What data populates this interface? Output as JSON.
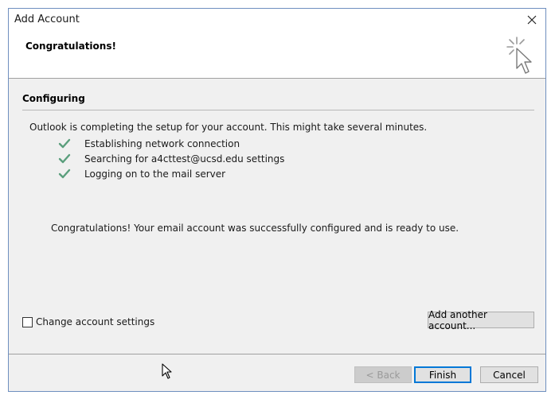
{
  "window": {
    "title": "Add Account",
    "close_glyph": "✕"
  },
  "header": {
    "title": "Congratulations!",
    "icon": "wizard-cursor-icon"
  },
  "section": {
    "title": "Configuring",
    "intro": "Outlook is completing the setup for your account. This might take several minutes.",
    "steps": [
      {
        "label": "Establishing network connection",
        "status": "done"
      },
      {
        "label": "Searching for a4cttest@ucsd.edu settings",
        "status": "done"
      },
      {
        "label": "Logging on to the mail server",
        "status": "done"
      }
    ],
    "success_message": "Congratulations! Your email account was successfully configured and is ready to use."
  },
  "options": {
    "change_settings_label": "Change account settings",
    "change_settings_checked": false,
    "add_another_label": "Add another account..."
  },
  "footer": {
    "back_label": "< Back",
    "finish_label": "Finish",
    "cancel_label": "Cancel"
  },
  "colors": {
    "check": "#5a9e7c",
    "accent": "#0078d7"
  }
}
